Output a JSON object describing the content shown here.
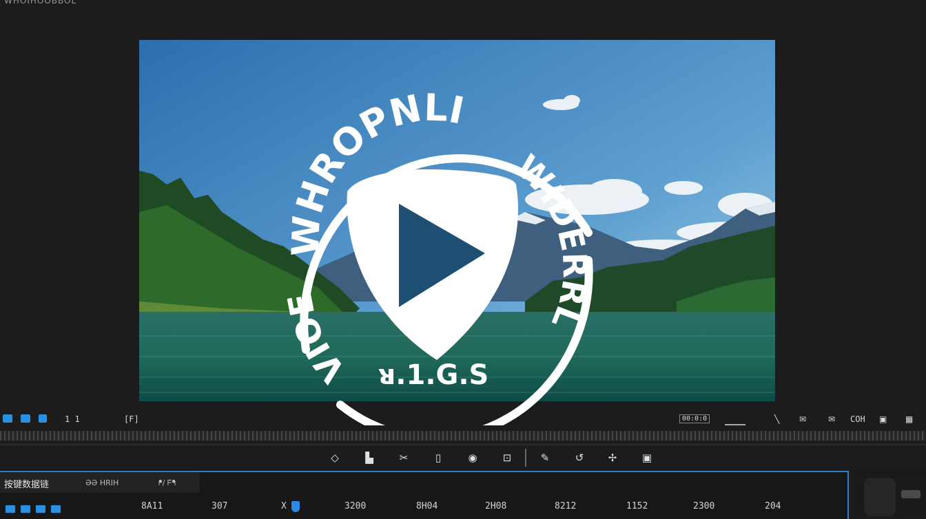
{
  "app": {
    "title": "WHOIHOOBBOL"
  },
  "preview": {
    "logo": {
      "top_arc_text": "WHROPNLI",
      "left_arc_text": "VIOE",
      "right_arc_text": "WIDERRL",
      "bottom_text": "ᴚ.1.G.S"
    }
  },
  "toolbar": {
    "counter": "1 1",
    "left_indicator": "[F]",
    "readout": "00:0:0",
    "right_label": "COH"
  },
  "transport": {
    "icons": [
      "diamond-icon",
      "bars-icon",
      "scissor-icon",
      "frame-icon",
      "camera-icon",
      "crop-icon",
      "pen-icon",
      "loop-icon",
      "star-icon",
      "export-icon"
    ]
  },
  "timeline": {
    "tabs": [
      {
        "label": "按键数据链"
      },
      {
        "label": "ƏƏ HRIH"
      },
      {
        "label": "ᖰ/ ᖴᖳ"
      }
    ],
    "markers": [
      "8A11",
      "307",
      "X",
      "3200",
      "8H04",
      "2H08",
      "8212",
      "1152",
      "2300",
      "204"
    ]
  },
  "colors": {
    "accent": "#2a90e0",
    "background": "#1c1c1c"
  }
}
